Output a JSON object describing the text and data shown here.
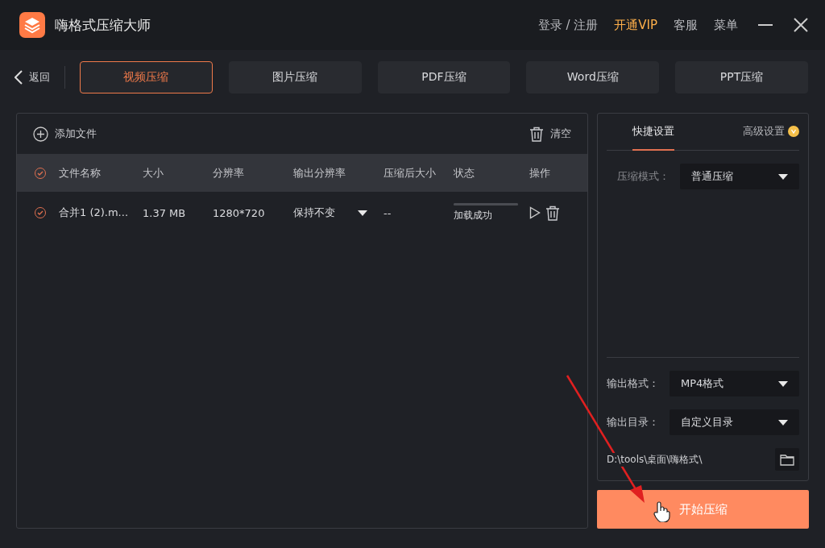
{
  "window": {
    "title": "嗨格式压缩大师",
    "links": [
      {
        "label": "登录 / 注册",
        "kind": "plain"
      },
      {
        "label": "开通VIP",
        "kind": "vip"
      },
      {
        "label": "客服",
        "kind": "plain"
      },
      {
        "label": "菜单",
        "kind": "plain"
      }
    ]
  },
  "back": "返回",
  "tabs": [
    {
      "label": "视频压缩",
      "selected": true
    },
    {
      "label": "图片压缩",
      "selected": false
    },
    {
      "label": "PDF压缩",
      "selected": false
    },
    {
      "label": "Word压缩",
      "selected": false
    },
    {
      "label": "PPT压缩",
      "selected": false
    }
  ],
  "toolbar": {
    "add": "添加文件",
    "clear": "清空"
  },
  "table": {
    "all_checked": true,
    "columns": [
      "文件名称",
      "大小",
      "分辨率",
      "输出分辨率",
      "压缩后大小",
      "状态",
      "操作"
    ],
    "rows": [
      {
        "checked": true,
        "name": "合并1 (2).m...",
        "size": "1.37 MB",
        "resolution": "1280*720",
        "output_resolution": "保持不变",
        "compressed_size": "--",
        "status": "加载成功",
        "level": 1
      }
    ]
  },
  "settings": {
    "tabs": [
      {
        "label": "快捷设置",
        "selected": true,
        "vip": false
      },
      {
        "label": "高级设置",
        "selected": false,
        "vip": true
      }
    ],
    "mode": {
      "label": "压缩模式：",
      "value": "普通压缩"
    },
    "format": {
      "label": "输出格式：",
      "value": "MP4格式"
    },
    "directory": {
      "label": "输出目录：",
      "value": "自定义目录"
    },
    "path": "D:\\tools\\桌面\\嗨格式\\"
  },
  "start_button": "开始压缩"
}
